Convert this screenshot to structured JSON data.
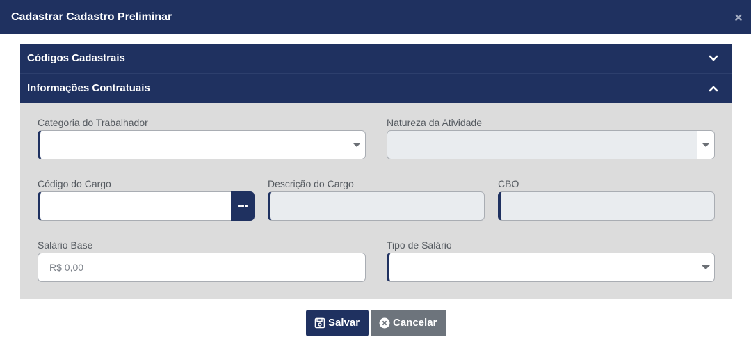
{
  "modal": {
    "title": "Cadastrar Cadastro Preliminar",
    "close_label": "×"
  },
  "accordion": {
    "section1": {
      "title": "Códigos Cadastrais",
      "expanded": false
    },
    "section2": {
      "title": "Informações Contratuais",
      "expanded": true
    }
  },
  "fields": {
    "categoria": {
      "label": "Categoria do Trabalhador",
      "value": ""
    },
    "natureza": {
      "label": "Natureza da Atividade",
      "value": ""
    },
    "codigo_cargo": {
      "label": "Código do Cargo",
      "value": ""
    },
    "descricao_cargo": {
      "label": "Descrição do Cargo",
      "value": ""
    },
    "cbo": {
      "label": "CBO",
      "value": ""
    },
    "salario_base": {
      "label": "Salário Base",
      "placeholder": "R$ 0,00"
    },
    "tipo_salario": {
      "label": "Tipo de Salário",
      "value": ""
    }
  },
  "buttons": {
    "save": "Salvar",
    "cancel": "Cancelar"
  },
  "colors": {
    "primary": "#1f3160",
    "secondary": "#6d747c",
    "panel_bg": "#dcdcdc",
    "disabled_bg": "#e9ecef"
  },
  "icons": {
    "close": "close-icon",
    "collapse_down": "chevron-down-icon",
    "collapse_up": "chevron-up-icon",
    "lookup": "ellipsis-icon",
    "save": "floppy-disk-icon",
    "cancel": "times-circle-icon"
  }
}
